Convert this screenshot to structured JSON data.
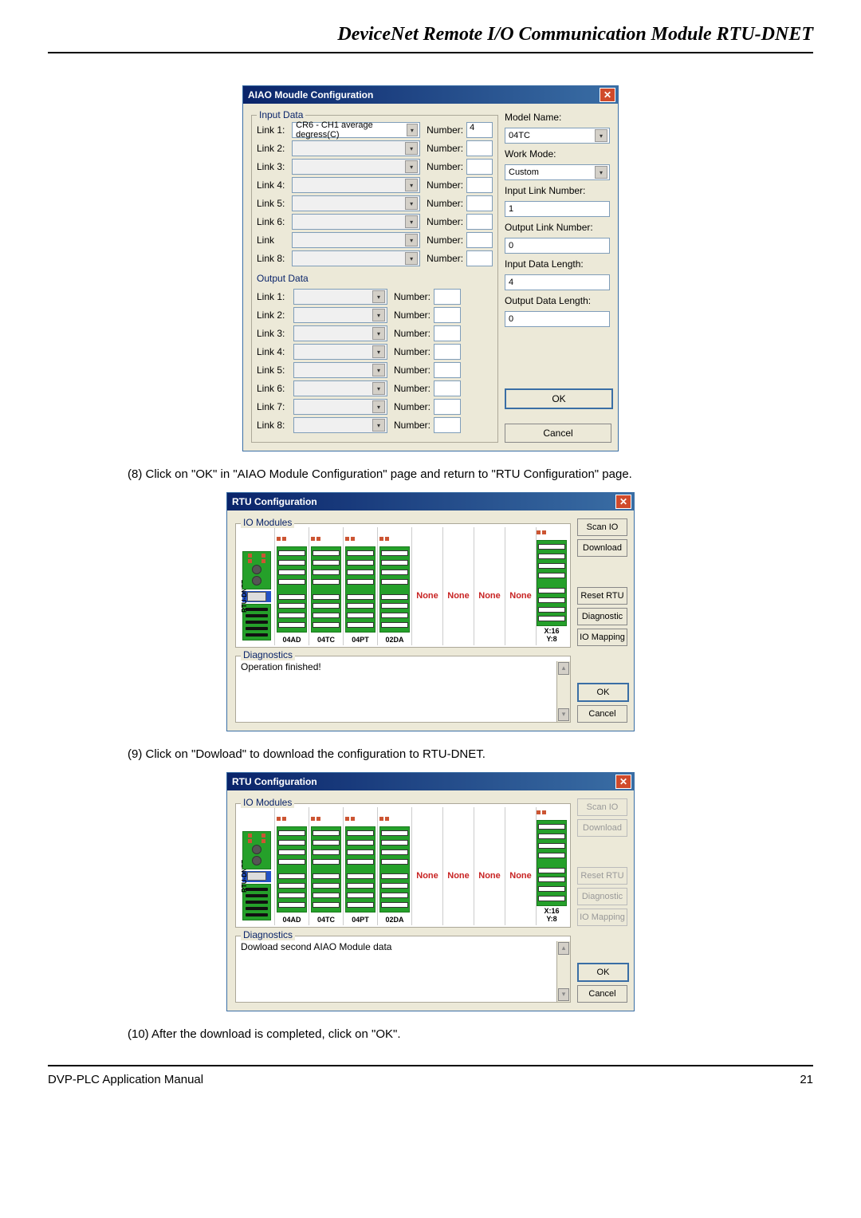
{
  "header_title": "DeviceNet Remote I/O Communication Module RTU-DNET",
  "aiao": {
    "title": "AIAO Moudle Configuration",
    "input_data_legend": "Input Data",
    "output_data_legend": "Output Data",
    "number_label": "Number:",
    "links_input": [
      {
        "label": "Link 1:",
        "value": "CR6 - CH1 average degress(C)",
        "enabled": true,
        "num": "4"
      },
      {
        "label": "Link 2:",
        "value": "",
        "enabled": false,
        "num": ""
      },
      {
        "label": "Link 3:",
        "value": "",
        "enabled": false,
        "num": ""
      },
      {
        "label": "Link 4:",
        "value": "",
        "enabled": false,
        "num": ""
      },
      {
        "label": "Link 5:",
        "value": "",
        "enabled": false,
        "num": ""
      },
      {
        "label": "Link 6:",
        "value": "",
        "enabled": false,
        "num": ""
      },
      {
        "label": "Link",
        "value": "",
        "enabled": false,
        "num": ""
      },
      {
        "label": "Link 8:",
        "value": "",
        "enabled": false,
        "num": ""
      }
    ],
    "links_output": [
      {
        "label": "Link 1:"
      },
      {
        "label": "Link 2:"
      },
      {
        "label": "Link 3:"
      },
      {
        "label": "Link 4:"
      },
      {
        "label": "Link 5:"
      },
      {
        "label": "Link 6:"
      },
      {
        "label": "Link 7:"
      },
      {
        "label": "Link 8:"
      }
    ],
    "right": {
      "model_name_label": "Model Name:",
      "model_name_value": "04TC",
      "work_mode_label": "Work Mode:",
      "work_mode_value": "Custom",
      "input_link_number_label": "Input Link Number:",
      "input_link_number_value": "1",
      "output_link_number_label": "Output Link Number:",
      "output_link_number_value": "0",
      "input_data_length_label": "Input Data Length:",
      "input_data_length_value": "4",
      "output_data_length_label": "Output Data Length:",
      "output_data_length_value": "0",
      "ok": "OK",
      "cancel": "Cancel"
    }
  },
  "step8": "(8) Click on \"OK\" in \"AIAO Module Configuration\" page and return to \"RTU Configuration\" page.",
  "rtu1": {
    "title": "RTU Configuration",
    "io_modules_legend": "IO Modules",
    "rtu_label": "RTU-DNET",
    "modules": [
      "04AD",
      "04TC",
      "04PT",
      "02DA"
    ],
    "none": "None",
    "ext": {
      "x": "X:16",
      "y": "Y:8"
    },
    "diag_legend": "Diagnostics",
    "diag_text": "Operation finished!",
    "buttons": {
      "scan": "Scan IO",
      "download": "Download",
      "reset": "Reset RTU",
      "diag": "Diagnostic",
      "iomap": "IO Mapping",
      "ok": "OK",
      "cancel": "Cancel"
    }
  },
  "step9": "(9) Click on \"Dowload\" to download the configuration to RTU-DNET.",
  "rtu2": {
    "diag_text": "Dowload second AIAO Module data"
  },
  "step10": "(10) After the download is completed, click on \"OK\".",
  "footer_left": "DVP-PLC Application Manual",
  "footer_right": "21"
}
